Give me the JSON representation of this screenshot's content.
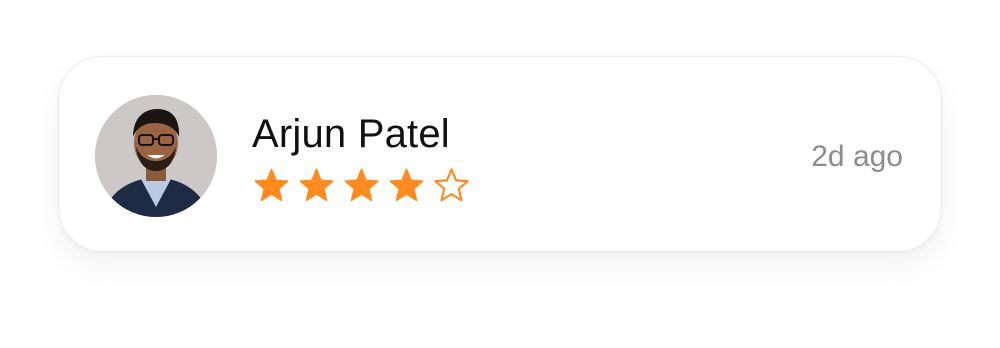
{
  "review": {
    "author_name": "Arjun Patel",
    "timestamp": "2d ago",
    "rating": 4,
    "rating_max": 5,
    "avatar_icon": "person-photo-avatar"
  },
  "colors": {
    "star_fill": "#FF8A1F",
    "name_text": "#111111",
    "timestamp_text": "#8C8C8C"
  }
}
